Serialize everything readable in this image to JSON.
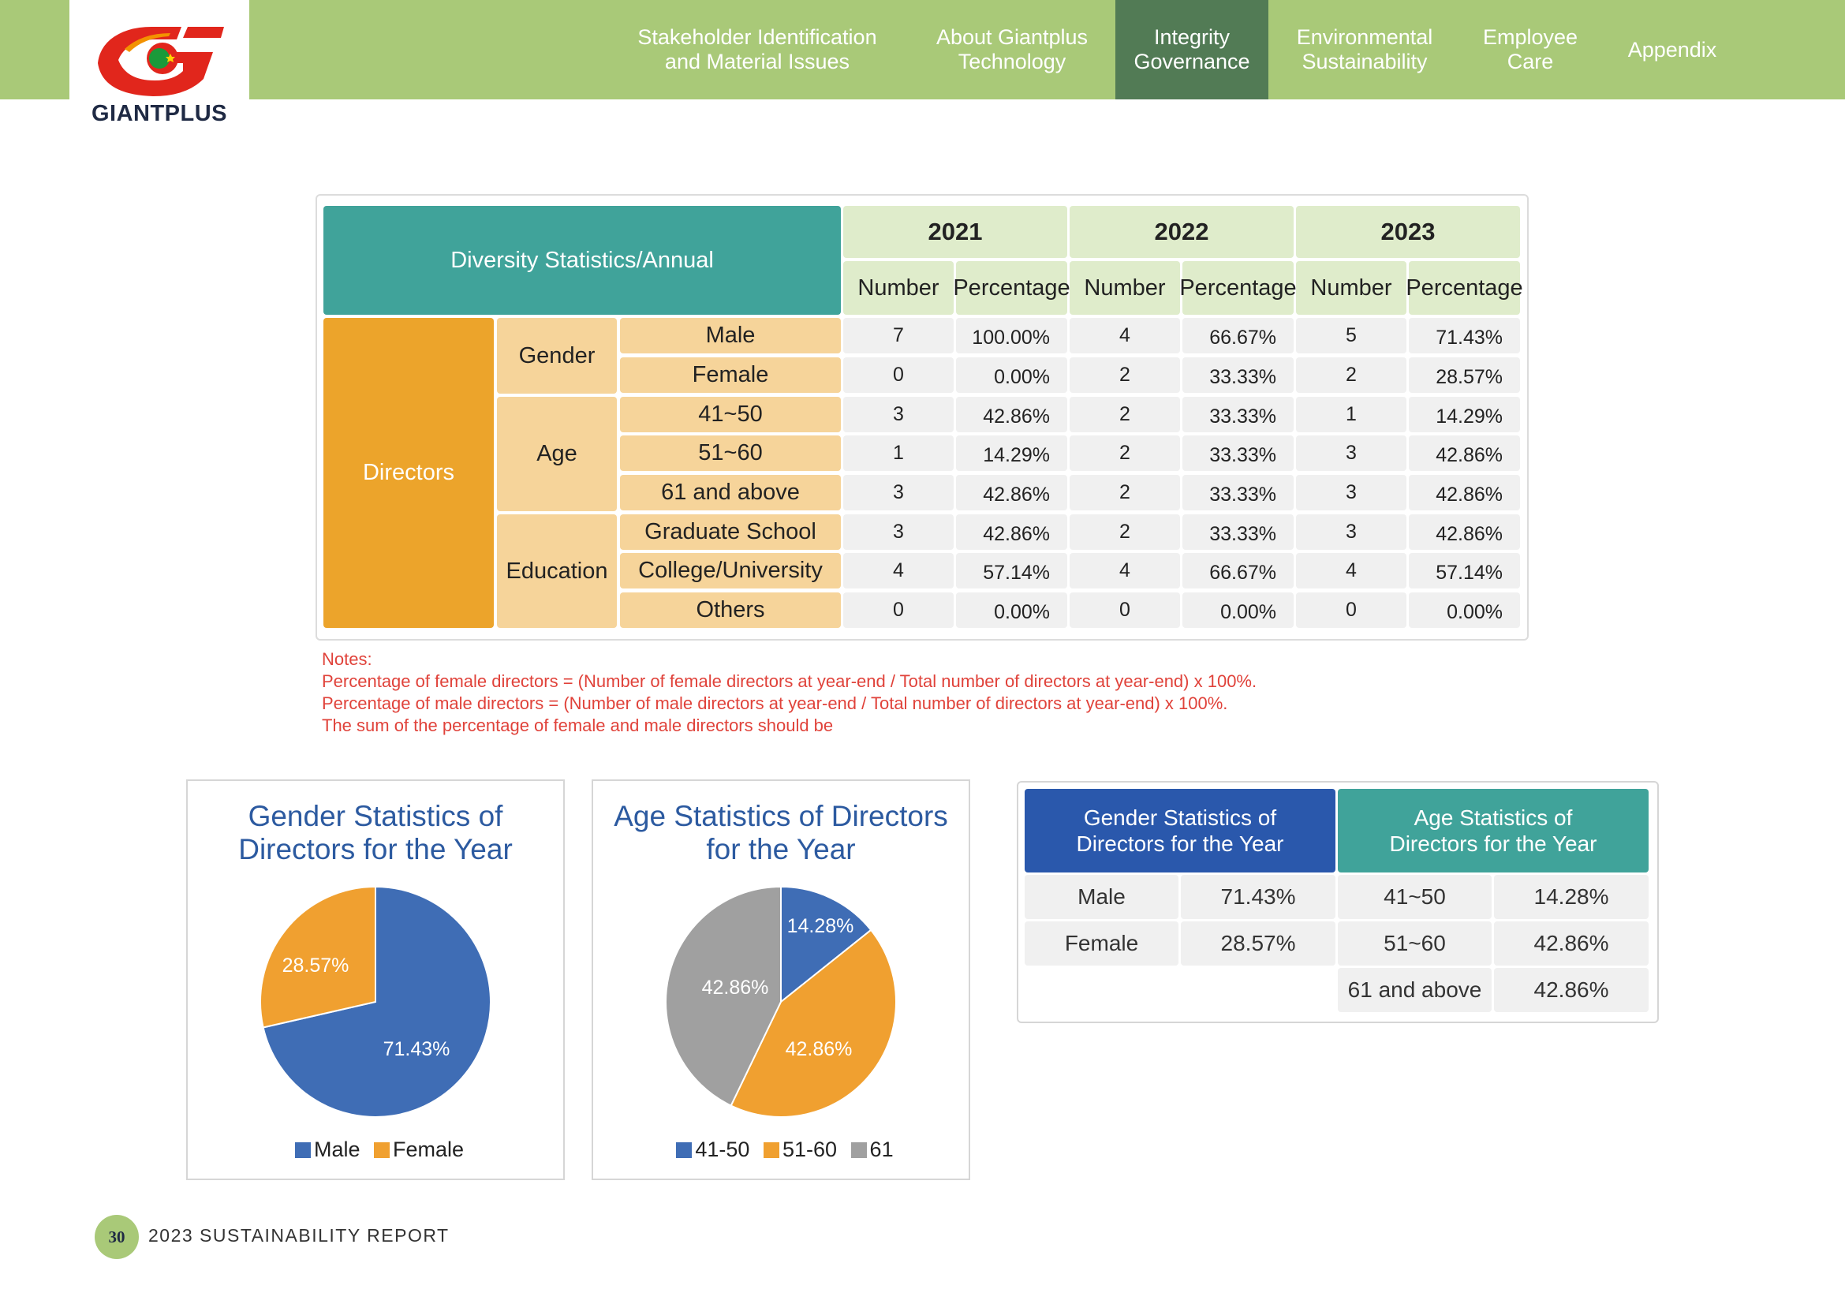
{
  "header": {
    "logo_text": "GIANTPLUS",
    "nav": [
      {
        "label": "Stakeholder Identification\nand Material Issues",
        "active": false
      },
      {
        "label": "About Giantplus\nTechnology",
        "active": false
      },
      {
        "label": "Integrity\nGovernance",
        "active": true
      },
      {
        "label": "Environmental\nSustainability",
        "active": false
      },
      {
        "label": "Employee\nCare",
        "active": false
      },
      {
        "label": "Appendix",
        "active": false
      }
    ]
  },
  "diversity_table": {
    "title": "Diversity Statistics/Annual",
    "years": [
      "2021",
      "2022",
      "2023"
    ],
    "col_number": "Number",
    "col_percentage": "Percentage",
    "group": "Directors",
    "categories": [
      "Gender",
      "Age",
      "Education"
    ],
    "rows": [
      {
        "label": "Male",
        "values": [
          [
            "7",
            "100.00%"
          ],
          [
            "4",
            "66.67%"
          ],
          [
            "5",
            "71.43%"
          ]
        ]
      },
      {
        "label": "Female",
        "values": [
          [
            "0",
            "0.00%"
          ],
          [
            "2",
            "33.33%"
          ],
          [
            "2",
            "28.57%"
          ]
        ]
      },
      {
        "label": "41~50",
        "values": [
          [
            "3",
            "42.86%"
          ],
          [
            "2",
            "33.33%"
          ],
          [
            "1",
            "14.29%"
          ]
        ]
      },
      {
        "label": "51~60",
        "values": [
          [
            "1",
            "14.29%"
          ],
          [
            "2",
            "33.33%"
          ],
          [
            "3",
            "42.86%"
          ]
        ]
      },
      {
        "label": "61 and above",
        "values": [
          [
            "3",
            "42.86%"
          ],
          [
            "2",
            "33.33%"
          ],
          [
            "3",
            "42.86%"
          ]
        ]
      },
      {
        "label": "Graduate School",
        "values": [
          [
            "3",
            "42.86%"
          ],
          [
            "2",
            "33.33%"
          ],
          [
            "3",
            "42.86%"
          ]
        ]
      },
      {
        "label": "College/University",
        "values": [
          [
            "4",
            "57.14%"
          ],
          [
            "4",
            "66.67%"
          ],
          [
            "4",
            "57.14%"
          ]
        ]
      },
      {
        "label": "Others",
        "values": [
          [
            "0",
            "0.00%"
          ],
          [
            "0",
            "0.00%"
          ],
          [
            "0",
            "0.00%"
          ]
        ]
      }
    ]
  },
  "notes": [
    "Notes:",
    "Percentage of female directors = (Number of female directors at year-end / Total number of directors at year-end) x 100%.",
    "Percentage of male directors = (Number of male directors at year-end / Total number of directors at year-end) x 100%.",
    "The sum of the percentage of female and male directors should be"
  ],
  "chart_data": [
    {
      "type": "pie",
      "title": "Gender Statistics of Directors for the Year",
      "categories": [
        "Male",
        "Female"
      ],
      "values": [
        71.43,
        28.57
      ],
      "labels": [
        "71.43%",
        "28.57%"
      ],
      "colors": [
        "#3f6db5",
        "#f0a030"
      ],
      "legend": [
        "Male",
        "Female"
      ],
      "legend_placement": "bottom"
    },
    {
      "type": "pie",
      "title": "Age Statistics of Directors for the Year",
      "categories": [
        "41-50",
        "51-60",
        "61"
      ],
      "values": [
        14.28,
        42.86,
        42.86
      ],
      "labels": [
        "14.28%",
        "42.86%",
        "42.86%"
      ],
      "colors": [
        "#3f6db5",
        "#f0a030",
        "#a0a0a0"
      ],
      "legend": [
        "41-50",
        "51-60",
        "61"
      ],
      "legend_placement": "bottom"
    }
  ],
  "summary_table": {
    "gender_header": "Gender Statistics of\nDirectors for the Year",
    "age_header": "Age Statistics of\nDirectors for the Year",
    "gender_rows": [
      [
        "Male",
        "71.43%"
      ],
      [
        "Female",
        "28.57%"
      ]
    ],
    "age_rows": [
      [
        "41~50",
        "14.28%"
      ],
      [
        "51~60",
        "42.86%"
      ],
      [
        "61 and above",
        "42.86%"
      ]
    ]
  },
  "footer": {
    "page_number": "30",
    "report_title": "2023 SUSTAINABILITY REPORT"
  },
  "colors": {
    "nav_green": "#a9c978",
    "nav_active": "#527b55",
    "teal": "#40a39a",
    "orange": "#eca42b",
    "peach": "#f6d49a",
    "blue": "#2a58ac",
    "note_red": "#e0423a"
  }
}
